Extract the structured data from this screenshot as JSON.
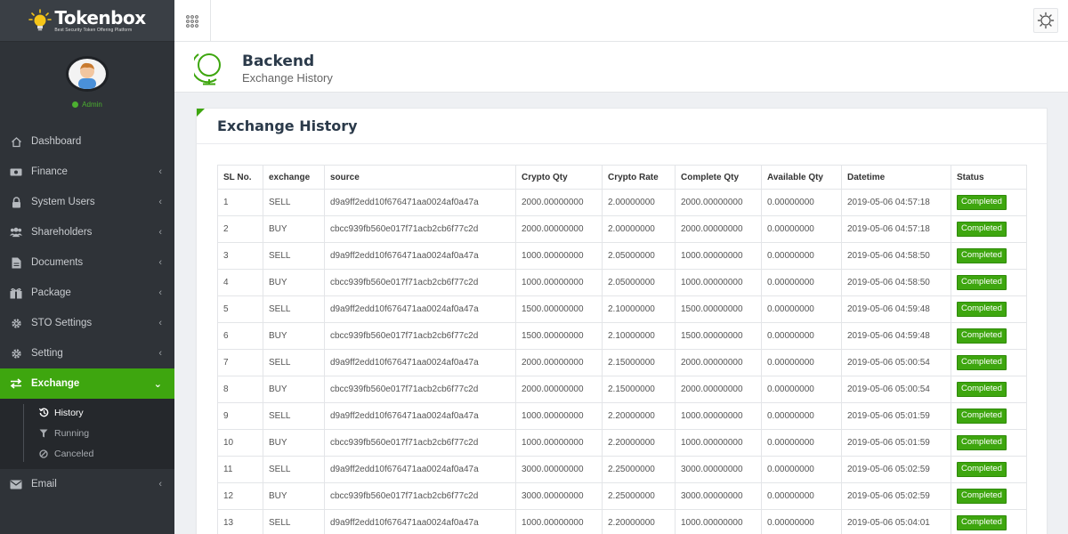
{
  "brand": {
    "name": "Tokenbox",
    "tagline": "Best Security Token Offering Platform"
  },
  "user": {
    "role": "Admin"
  },
  "nav": {
    "items": [
      {
        "label": "Dashboard",
        "icon": "home-icon",
        "has_chevron": false
      },
      {
        "label": "Finance",
        "icon": "money-icon",
        "has_chevron": true
      },
      {
        "label": "System Users",
        "icon": "lock-icon",
        "has_chevron": true
      },
      {
        "label": "Shareholders",
        "icon": "users-icon",
        "has_chevron": true
      },
      {
        "label": "Documents",
        "icon": "document-icon",
        "has_chevron": true
      },
      {
        "label": "Package",
        "icon": "package-icon",
        "has_chevron": true
      },
      {
        "label": "STO Settings",
        "icon": "gear-icon",
        "has_chevron": true
      },
      {
        "label": "Setting",
        "icon": "gear-icon",
        "has_chevron": true
      },
      {
        "label": "Exchange",
        "icon": "exchange-icon",
        "has_chevron": true,
        "active": true
      },
      {
        "label": "Email",
        "icon": "envelope-icon",
        "has_chevron": true
      }
    ],
    "exchange_sub": [
      {
        "label": "History",
        "icon": "history-icon"
      },
      {
        "label": "Running",
        "icon": "filter-icon"
      },
      {
        "label": "Canceled",
        "icon": "ban-icon"
      }
    ],
    "chevron_left": "‹",
    "chevron_down": "⌄"
  },
  "page": {
    "title": "Backend",
    "subtitle": "Exchange History"
  },
  "card": {
    "title": "Exchange History"
  },
  "table": {
    "columns": [
      "SL No.",
      "exchange",
      "source",
      "Crypto Qty",
      "Crypto Rate",
      "Complete Qty",
      "Available Qty",
      "Datetime",
      "Status"
    ],
    "rows": [
      [
        "1",
        "SELL",
        "d9a9ff2edd10f676471aa0024af0a47a",
        "2000.00000000",
        "2.00000000",
        "2000.00000000",
        "0.00000000",
        "2019-05-06 04:57:18",
        "Completed"
      ],
      [
        "2",
        "BUY",
        "cbcc939fb560e017f71acb2cb6f77c2d",
        "2000.00000000",
        "2.00000000",
        "2000.00000000",
        "0.00000000",
        "2019-05-06 04:57:18",
        "Completed"
      ],
      [
        "3",
        "SELL",
        "d9a9ff2edd10f676471aa0024af0a47a",
        "1000.00000000",
        "2.05000000",
        "1000.00000000",
        "0.00000000",
        "2019-05-06 04:58:50",
        "Completed"
      ],
      [
        "4",
        "BUY",
        "cbcc939fb560e017f71acb2cb6f77c2d",
        "1000.00000000",
        "2.05000000",
        "1000.00000000",
        "0.00000000",
        "2019-05-06 04:58:50",
        "Completed"
      ],
      [
        "5",
        "SELL",
        "d9a9ff2edd10f676471aa0024af0a47a",
        "1500.00000000",
        "2.10000000",
        "1500.00000000",
        "0.00000000",
        "2019-05-06 04:59:48",
        "Completed"
      ],
      [
        "6",
        "BUY",
        "cbcc939fb560e017f71acb2cb6f77c2d",
        "1500.00000000",
        "2.10000000",
        "1500.00000000",
        "0.00000000",
        "2019-05-06 04:59:48",
        "Completed"
      ],
      [
        "7",
        "SELL",
        "d9a9ff2edd10f676471aa0024af0a47a",
        "2000.00000000",
        "2.15000000",
        "2000.00000000",
        "0.00000000",
        "2019-05-06 05:00:54",
        "Completed"
      ],
      [
        "8",
        "BUY",
        "cbcc939fb560e017f71acb2cb6f77c2d",
        "2000.00000000",
        "2.15000000",
        "2000.00000000",
        "0.00000000",
        "2019-05-06 05:00:54",
        "Completed"
      ],
      [
        "9",
        "SELL",
        "d9a9ff2edd10f676471aa0024af0a47a",
        "1000.00000000",
        "2.20000000",
        "1000.00000000",
        "0.00000000",
        "2019-05-06 05:01:59",
        "Completed"
      ],
      [
        "10",
        "BUY",
        "cbcc939fb560e017f71acb2cb6f77c2d",
        "1000.00000000",
        "2.20000000",
        "1000.00000000",
        "0.00000000",
        "2019-05-06 05:01:59",
        "Completed"
      ],
      [
        "11",
        "SELL",
        "d9a9ff2edd10f676471aa0024af0a47a",
        "3000.00000000",
        "2.25000000",
        "3000.00000000",
        "0.00000000",
        "2019-05-06 05:02:59",
        "Completed"
      ],
      [
        "12",
        "BUY",
        "cbcc939fb560e017f71acb2cb6f77c2d",
        "3000.00000000",
        "2.25000000",
        "3000.00000000",
        "0.00000000",
        "2019-05-06 05:02:59",
        "Completed"
      ],
      [
        "13",
        "SELL",
        "d9a9ff2edd10f676471aa0024af0a47a",
        "1000.00000000",
        "2.20000000",
        "1000.00000000",
        "0.00000000",
        "2019-05-06 05:04:01",
        "Completed"
      ]
    ]
  },
  "icons": {
    "apps": "apps-grid-icon",
    "settings": "sun-gear-icon",
    "page": "globe-icon"
  },
  "colors": {
    "accent": "#3ea60f",
    "sidebar": "#2f3338",
    "online": "#4caf30"
  }
}
